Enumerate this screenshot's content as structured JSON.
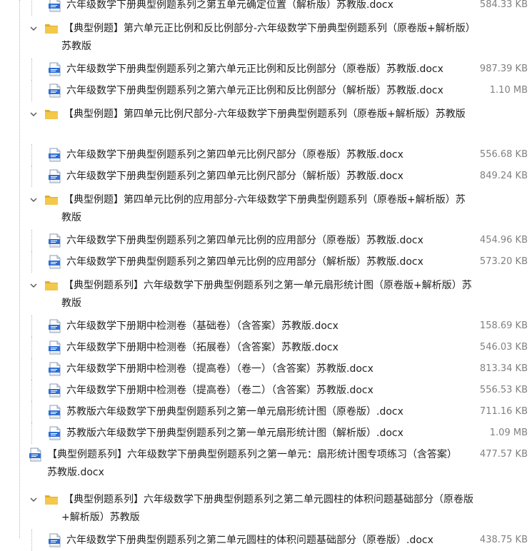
{
  "icons": {
    "file": "word-doc-icon",
    "folder": "folder-icon",
    "expanded": "chevron-down-icon"
  },
  "colors": {
    "folder_fill": "#f3c84b",
    "doc_band": "#2f6fd6",
    "size_text": "#808080",
    "tree_line": "#b8b8b8"
  },
  "entries": [
    {
      "type": "file",
      "name": "六年级数学下册典型例题系列之第五单元确定位置（解析版）苏教版.docx",
      "size": "584.33 KB"
    },
    {
      "type": "folder",
      "name": "【典型例题】第六单元正比例和反比例部分-六年级数学下册典型例题系列（原卷版+解析版）苏教版"
    },
    {
      "type": "file",
      "name": "六年级数学下册典型例题系列之第六单元正比例和反比例部分（原卷版）苏教版.docx",
      "size": "987.39 KB"
    },
    {
      "type": "file",
      "name": "六年级数学下册典型例题系列之第六单元正比例和反比例部分（解析版）苏教版.docx",
      "size": "1.10 MB"
    },
    {
      "type": "folder",
      "name": "【典型例题】第四单元比例尺部分-六年级数学下册典型例题系列（原卷版+解析版）苏教版"
    },
    {
      "type": "file",
      "name": "六年级数学下册典型例题系列之第四单元比例尺部分（原卷版）苏教版.docx",
      "size": "556.68 KB"
    },
    {
      "type": "file",
      "name": "六年级数学下册典型例题系列之第四单元比例尺部分（解析版）苏教版.docx",
      "size": "849.24 KB"
    },
    {
      "type": "folder",
      "name": "【典型例题】第四单元比例的应用部分-六年级数学下册典型例题系列（原卷版+解析版）苏教版"
    },
    {
      "type": "file",
      "name": "六年级数学下册典型例题系列之第四单元比例的应用部分（原卷版）苏教版.docx",
      "size": "454.96 KB"
    },
    {
      "type": "file",
      "name": "六年级数学下册典型例题系列之第四单元比例的应用部分（解析版）苏教版.docx",
      "size": "573.20 KB"
    },
    {
      "type": "folder",
      "name": "【典型例题系列】六年级数学下册典型例题系列之第一单元扇形统计图（原卷版+解析版）苏教版"
    },
    {
      "type": "file",
      "name": "六年级数学下册期中检测卷（基础卷）（含答案）苏教版.docx",
      "size": "158.69 KB"
    },
    {
      "type": "file",
      "name": "六年级数学下册期中检测卷（拓展卷）（含答案）苏教版.docx",
      "size": "546.03 KB"
    },
    {
      "type": "file",
      "name": "六年级数学下册期中检测卷（提高卷）（卷一）（含答案）苏教版.docx",
      "size": "813.34 KB"
    },
    {
      "type": "file",
      "name": "六年级数学下册期中检测卷（提高卷）（卷二）（含答案）苏教版.docx",
      "size": "556.53 KB"
    },
    {
      "type": "file",
      "name": "苏教版六年级数学下册典型例题系列之第一单元扇形统计图（原卷版）.docx",
      "size": "711.16 KB"
    },
    {
      "type": "file",
      "name": "苏教版六年级数学下册典型例题系列之第一单元扇形统计图（解析版）.docx",
      "size": "1.09 MB"
    },
    {
      "type": "rootfile",
      "name": "【典型例题系列】六年级数学下册典型例题系列之第一单元：扇形统计图专项练习（含答案）苏教版.docx",
      "size": "477.57 KB"
    },
    {
      "type": "folder",
      "name": "【典型例题系列】六年级数学下册典型例题系列之第二单元圆柱的体积问题基础部分（原卷版+解析版）苏教版"
    },
    {
      "type": "file",
      "name": "六年级数学下册典型例题系列之第二单元圆柱的体积问题基础部分（原卷版）.docx",
      "size": "438.75 KB"
    }
  ]
}
